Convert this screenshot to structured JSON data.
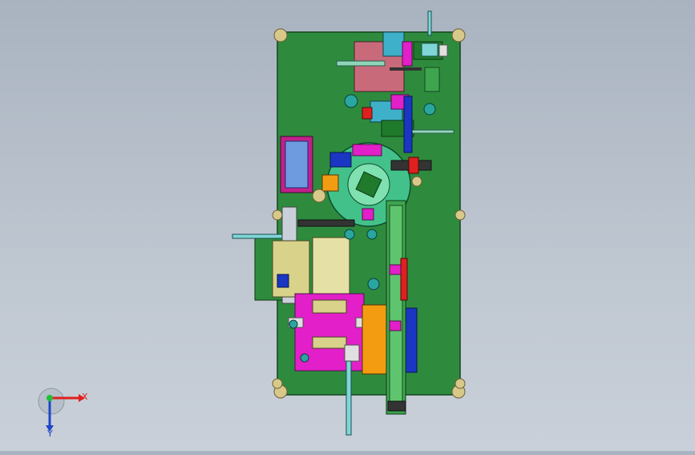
{
  "viewport": {
    "background_top": "#a9b3c0",
    "background_bottom": "#c9d0d9"
  },
  "triad": {
    "x_label": "X",
    "y_label": "Y",
    "x_color": "#e0201e",
    "y_color": "#1c46c8",
    "origin_color": "#1fbf3a"
  },
  "model": {
    "plate_color": "#2e8b3e",
    "accent_colors": [
      "#e21fc8",
      "#f39c12",
      "#1a36c2",
      "#7fd6d6",
      "#c96a7a",
      "#1f7a2b"
    ]
  }
}
